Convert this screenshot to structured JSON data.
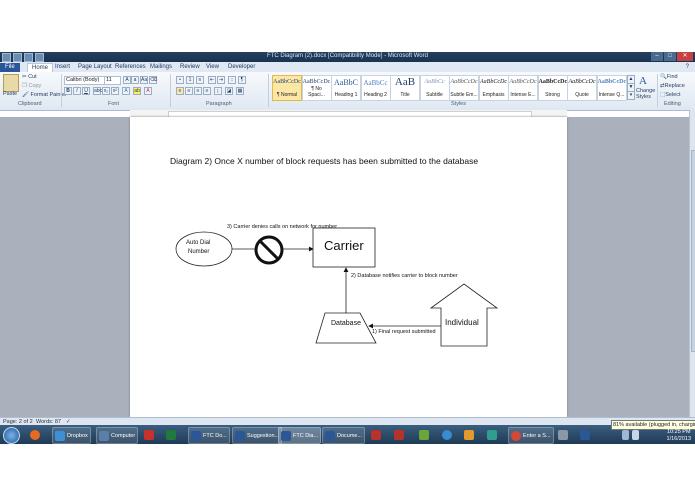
{
  "window": {
    "title": "FTC Diagram (2).docx [Compatibility Mode] - Microsoft Word"
  },
  "ribbon_tabs": [
    "File",
    "Home",
    "Insert",
    "Page Layout",
    "References",
    "Mailings",
    "Review",
    "View",
    "Developer"
  ],
  "clipboard": {
    "paste": "Paste",
    "cut": "Cut",
    "copy": "Copy",
    "format_painter": "Format Painter",
    "group_label": "Clipboard"
  },
  "font": {
    "name": "Calibri (Body)",
    "size": "11",
    "group_label": "Font"
  },
  "paragraph": {
    "group_label": "Paragraph"
  },
  "styles": {
    "group_label": "Styles",
    "items": [
      {
        "sample": "AaBbCcDc",
        "name": "¶ Normal",
        "selected": true
      },
      {
        "sample": "AaBbCcDc",
        "name": "¶ No Spaci...",
        "selected": false
      },
      {
        "sample": "AaBbC",
        "name": "Heading 1",
        "selected": false
      },
      {
        "sample": "AaBbCc",
        "name": "Heading 2",
        "selected": false
      },
      {
        "sample": "AaB",
        "name": "Title",
        "selected": false
      },
      {
        "sample": "AaBbCc",
        "name": "Subtitle",
        "selected": false
      },
      {
        "sample": "AaBbCcDc",
        "name": "Subtle Em...",
        "selected": false
      },
      {
        "sample": "AaBbCcDc",
        "name": "Emphasis",
        "selected": false
      },
      {
        "sample": "AaBbCcDc",
        "name": "Intense E...",
        "selected": false
      },
      {
        "sample": "AaBbCcDc",
        "name": "Strong",
        "selected": false
      },
      {
        "sample": "AaBbCcDc",
        "name": "Quote",
        "selected": false
      },
      {
        "sample": "AaBbCcDc",
        "name": "Intense Q...",
        "selected": false
      }
    ],
    "change_styles": "Change Styles"
  },
  "editing": {
    "find": "Find",
    "replace": "Replace",
    "select": "Select",
    "group_label": "Editing"
  },
  "document": {
    "heading": "Diagram 2) Once X number of block requests  has been submitted to the database",
    "diagram": {
      "autodial_line1": "Auto Dial",
      "autodial_line2": "Number",
      "carrier": "Carrier",
      "database": "Database",
      "individual": "Individual",
      "step1": "1) Final request submitted",
      "step2": "2) Database notifies carrier to block number",
      "step3": "3) Carrier denies calls on network for number"
    }
  },
  "statusbar": {
    "page": "Page: 2 of 2",
    "words": "Words: 87"
  },
  "taskbar": {
    "items": [
      {
        "label": "Dropbox",
        "color": "#3d8fd6"
      },
      {
        "label": "Computer",
        "color": "#5b7fa8"
      },
      {
        "label": "FTC Do...",
        "color": "#2b5797"
      },
      {
        "label": "Suggestion...",
        "color": "#2b5797"
      },
      {
        "label": "FTC Dia...",
        "color": "#2b5797"
      },
      {
        "label": "Docume...",
        "color": "#2b5797"
      },
      {
        "label": "Enter a S...",
        "color": "#d34836"
      }
    ],
    "battery_tip": "81% available (plugged in, charging)",
    "time": "10:25 PM",
    "date": "1/16/2013"
  }
}
